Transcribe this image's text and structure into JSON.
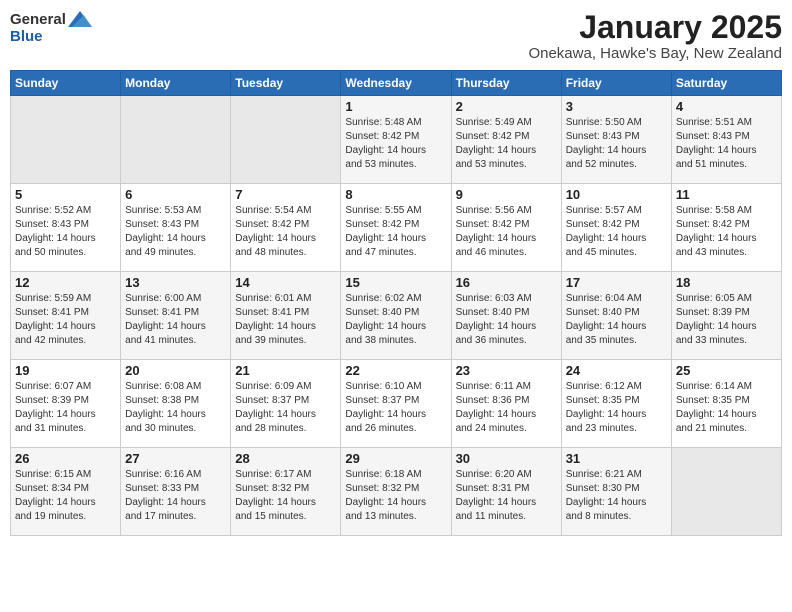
{
  "header": {
    "logo_general": "General",
    "logo_blue": "Blue",
    "month": "January 2025",
    "location": "Onekawa, Hawke's Bay, New Zealand"
  },
  "weekdays": [
    "Sunday",
    "Monday",
    "Tuesday",
    "Wednesday",
    "Thursday",
    "Friday",
    "Saturday"
  ],
  "weeks": [
    [
      {
        "day": "",
        "info": ""
      },
      {
        "day": "",
        "info": ""
      },
      {
        "day": "",
        "info": ""
      },
      {
        "day": "1",
        "info": "Sunrise: 5:48 AM\nSunset: 8:42 PM\nDaylight: 14 hours\nand 53 minutes."
      },
      {
        "day": "2",
        "info": "Sunrise: 5:49 AM\nSunset: 8:42 PM\nDaylight: 14 hours\nand 53 minutes."
      },
      {
        "day": "3",
        "info": "Sunrise: 5:50 AM\nSunset: 8:43 PM\nDaylight: 14 hours\nand 52 minutes."
      },
      {
        "day": "4",
        "info": "Sunrise: 5:51 AM\nSunset: 8:43 PM\nDaylight: 14 hours\nand 51 minutes."
      }
    ],
    [
      {
        "day": "5",
        "info": "Sunrise: 5:52 AM\nSunset: 8:43 PM\nDaylight: 14 hours\nand 50 minutes."
      },
      {
        "day": "6",
        "info": "Sunrise: 5:53 AM\nSunset: 8:43 PM\nDaylight: 14 hours\nand 49 minutes."
      },
      {
        "day": "7",
        "info": "Sunrise: 5:54 AM\nSunset: 8:42 PM\nDaylight: 14 hours\nand 48 minutes."
      },
      {
        "day": "8",
        "info": "Sunrise: 5:55 AM\nSunset: 8:42 PM\nDaylight: 14 hours\nand 47 minutes."
      },
      {
        "day": "9",
        "info": "Sunrise: 5:56 AM\nSunset: 8:42 PM\nDaylight: 14 hours\nand 46 minutes."
      },
      {
        "day": "10",
        "info": "Sunrise: 5:57 AM\nSunset: 8:42 PM\nDaylight: 14 hours\nand 45 minutes."
      },
      {
        "day": "11",
        "info": "Sunrise: 5:58 AM\nSunset: 8:42 PM\nDaylight: 14 hours\nand 43 minutes."
      }
    ],
    [
      {
        "day": "12",
        "info": "Sunrise: 5:59 AM\nSunset: 8:41 PM\nDaylight: 14 hours\nand 42 minutes."
      },
      {
        "day": "13",
        "info": "Sunrise: 6:00 AM\nSunset: 8:41 PM\nDaylight: 14 hours\nand 41 minutes."
      },
      {
        "day": "14",
        "info": "Sunrise: 6:01 AM\nSunset: 8:41 PM\nDaylight: 14 hours\nand 39 minutes."
      },
      {
        "day": "15",
        "info": "Sunrise: 6:02 AM\nSunset: 8:40 PM\nDaylight: 14 hours\nand 38 minutes."
      },
      {
        "day": "16",
        "info": "Sunrise: 6:03 AM\nSunset: 8:40 PM\nDaylight: 14 hours\nand 36 minutes."
      },
      {
        "day": "17",
        "info": "Sunrise: 6:04 AM\nSunset: 8:40 PM\nDaylight: 14 hours\nand 35 minutes."
      },
      {
        "day": "18",
        "info": "Sunrise: 6:05 AM\nSunset: 8:39 PM\nDaylight: 14 hours\nand 33 minutes."
      }
    ],
    [
      {
        "day": "19",
        "info": "Sunrise: 6:07 AM\nSunset: 8:39 PM\nDaylight: 14 hours\nand 31 minutes."
      },
      {
        "day": "20",
        "info": "Sunrise: 6:08 AM\nSunset: 8:38 PM\nDaylight: 14 hours\nand 30 minutes."
      },
      {
        "day": "21",
        "info": "Sunrise: 6:09 AM\nSunset: 8:37 PM\nDaylight: 14 hours\nand 28 minutes."
      },
      {
        "day": "22",
        "info": "Sunrise: 6:10 AM\nSunset: 8:37 PM\nDaylight: 14 hours\nand 26 minutes."
      },
      {
        "day": "23",
        "info": "Sunrise: 6:11 AM\nSunset: 8:36 PM\nDaylight: 14 hours\nand 24 minutes."
      },
      {
        "day": "24",
        "info": "Sunrise: 6:12 AM\nSunset: 8:35 PM\nDaylight: 14 hours\nand 23 minutes."
      },
      {
        "day": "25",
        "info": "Sunrise: 6:14 AM\nSunset: 8:35 PM\nDaylight: 14 hours\nand 21 minutes."
      }
    ],
    [
      {
        "day": "26",
        "info": "Sunrise: 6:15 AM\nSunset: 8:34 PM\nDaylight: 14 hours\nand 19 minutes."
      },
      {
        "day": "27",
        "info": "Sunrise: 6:16 AM\nSunset: 8:33 PM\nDaylight: 14 hours\nand 17 minutes."
      },
      {
        "day": "28",
        "info": "Sunrise: 6:17 AM\nSunset: 8:32 PM\nDaylight: 14 hours\nand 15 minutes."
      },
      {
        "day": "29",
        "info": "Sunrise: 6:18 AM\nSunset: 8:32 PM\nDaylight: 14 hours\nand 13 minutes."
      },
      {
        "day": "30",
        "info": "Sunrise: 6:20 AM\nSunset: 8:31 PM\nDaylight: 14 hours\nand 11 minutes."
      },
      {
        "day": "31",
        "info": "Sunrise: 6:21 AM\nSunset: 8:30 PM\nDaylight: 14 hours\nand 8 minutes."
      },
      {
        "day": "",
        "info": ""
      }
    ]
  ]
}
